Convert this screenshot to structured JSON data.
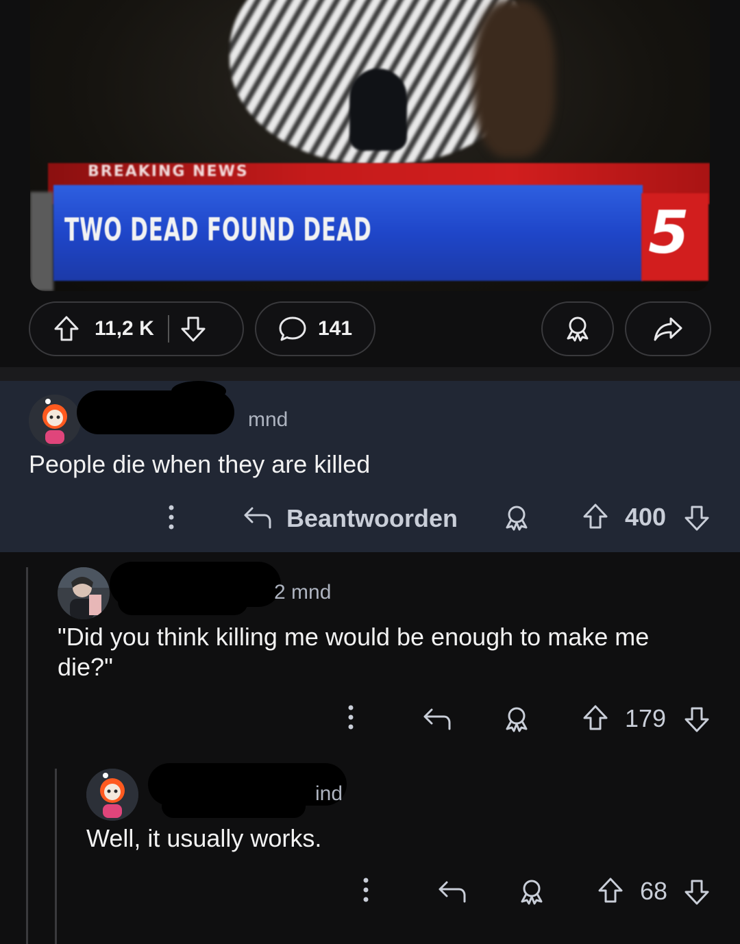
{
  "post": {
    "image": {
      "breaking_label": "BREAKING NEWS",
      "chyron": "TWO DEAD FOUND DEAD",
      "channel": "5"
    },
    "upvotes": "11,2 K",
    "comments": "141"
  },
  "comments": [
    {
      "time": "mnd",
      "text": "People die when they are killed",
      "reply_label": "Beantwoorden",
      "score": "400"
    },
    {
      "time": "2 mnd",
      "text": "\"Did you think killing me would be enough to make me die?\"",
      "score": "179"
    },
    {
      "time": "ind",
      "text": "Well, it usually works.",
      "score": "68"
    }
  ],
  "colors": {
    "background": "#0f0f10",
    "highlight": "#212734",
    "chyron_blue": "#1f46c9",
    "breaking_red": "#c51b1b"
  }
}
